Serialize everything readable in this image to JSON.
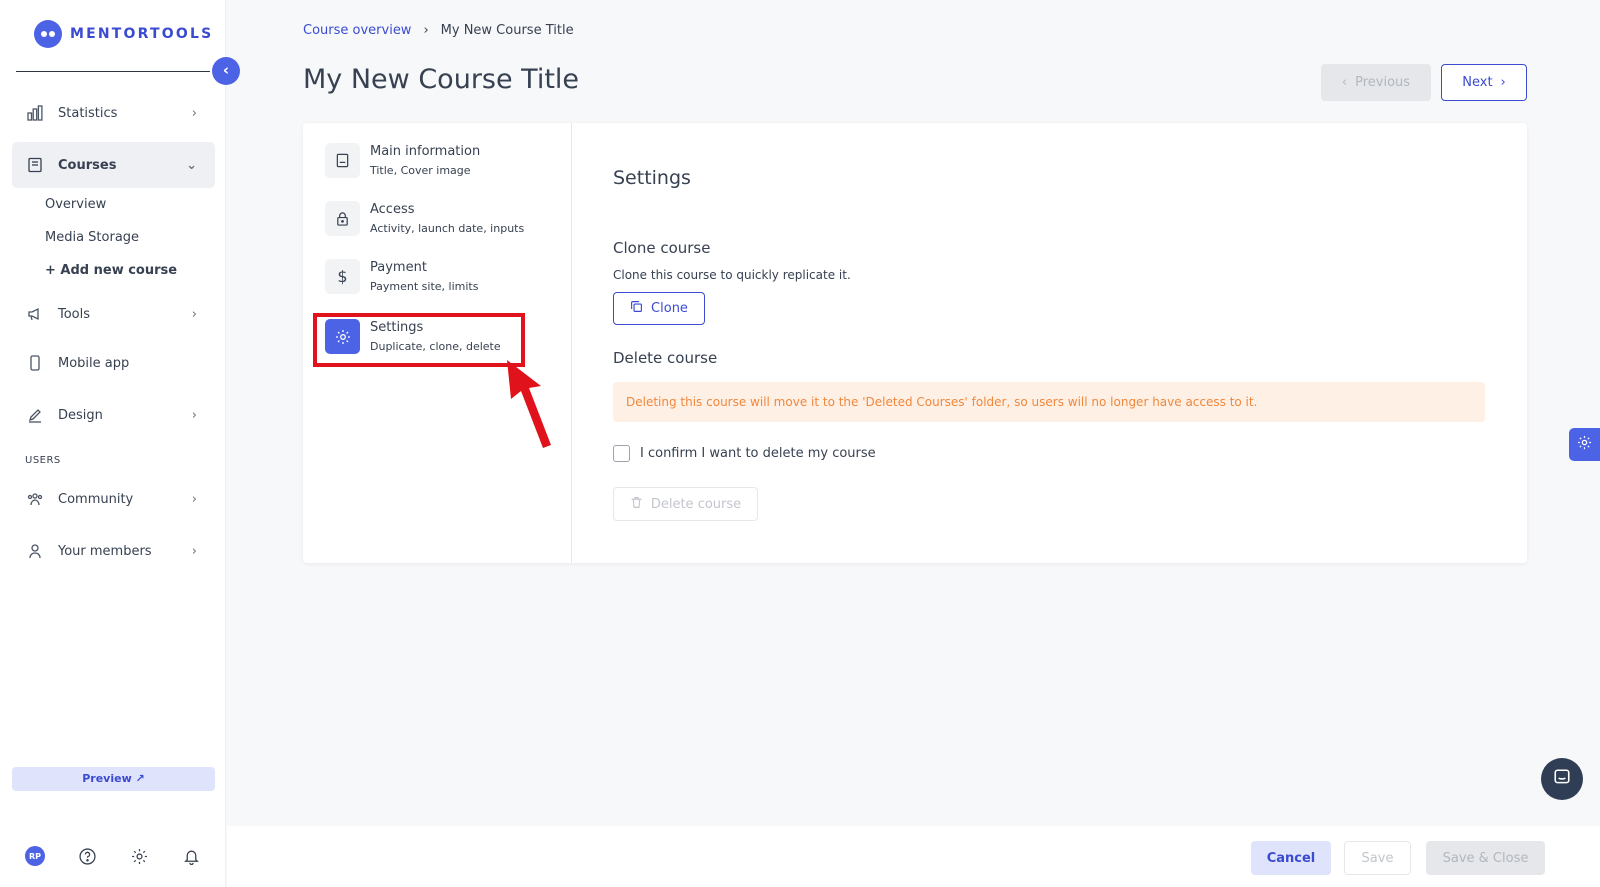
{
  "brand": {
    "name": "MENTORTOOLS",
    "accent": "#4d63e6"
  },
  "sidebar": {
    "items": [
      {
        "label": "Statistics",
        "icon": "bar-chart-icon"
      },
      {
        "label": "Courses",
        "icon": "book-icon"
      },
      {
        "label": "Tools",
        "icon": "megaphone-icon"
      },
      {
        "label": "Mobile app",
        "icon": "phone-icon"
      },
      {
        "label": "Design",
        "icon": "pencil-icon"
      },
      {
        "label": "Community",
        "icon": "people-icon"
      },
      {
        "label": "Your members",
        "icon": "person-icon"
      }
    ],
    "courses_sub": [
      "Overview",
      "Media Storage",
      "+ Add new course"
    ],
    "users_label": "USERS",
    "preview_label": "Preview ↗",
    "avatar_initials": "RP"
  },
  "breadcrumb": {
    "link": "Course overview",
    "current": "My New Course Title"
  },
  "page_title": "My New Course Title",
  "nav_buttons": {
    "previous": "Previous",
    "next": "Next"
  },
  "steps": [
    {
      "title": "Main information",
      "subtitle": "Title, Cover image",
      "icon": "document-icon"
    },
    {
      "title": "Access",
      "subtitle": "Activity, launch date, inputs",
      "icon": "lock-icon"
    },
    {
      "title": "Payment",
      "subtitle": "Payment site, limits",
      "icon": "dollar-icon"
    },
    {
      "title": "Settings",
      "subtitle": "Duplicate, clone, delete",
      "icon": "gear-icon"
    }
  ],
  "settings": {
    "title": "Settings",
    "clone_heading": "Clone course",
    "clone_text": "Clone this course to quickly replicate it.",
    "clone_button": "Clone",
    "delete_heading": "Delete course",
    "delete_warning": "Deleting this course will move it to the 'Deleted Courses' folder, so users will no longer have access to it.",
    "confirm_label": "I confirm I want to delete my course",
    "delete_button": "Delete course"
  },
  "footer": {
    "cancel": "Cancel",
    "save": "Save",
    "save_close": "Save & Close"
  }
}
